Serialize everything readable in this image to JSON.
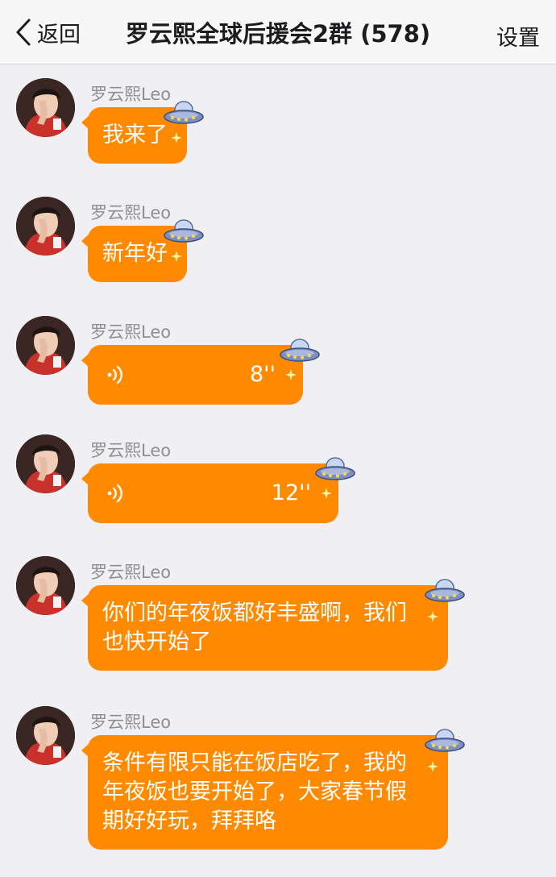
{
  "header": {
    "back_label": "返回",
    "title": "罗云熙全球后援会2群 (578)",
    "settings_label": "设置"
  },
  "colors": {
    "bubble": "#ff8a00",
    "background": "#efeff4",
    "nav_background": "#f7f7f8"
  },
  "icons": {
    "back": "chevron-left-icon",
    "avatar": "avatar",
    "voice": "voice-wave-icon",
    "decoration": "ufo-icon"
  },
  "messages": [
    {
      "sender": "罗云熙Leo",
      "type": "text",
      "text": "我来了"
    },
    {
      "sender": "罗云熙Leo",
      "type": "text",
      "text": "新年好"
    },
    {
      "sender": "罗云熙Leo",
      "type": "voice",
      "duration": "8''"
    },
    {
      "sender": "罗云熙Leo",
      "type": "voice",
      "duration": "12''"
    },
    {
      "sender": "罗云熙Leo",
      "type": "text",
      "text": "你们的年夜饭都好丰盛啊，我们\n也快开始了"
    },
    {
      "sender": "罗云熙Leo",
      "type": "text",
      "text": "条件有限只能在饭店吃了，我的\n年夜饭也要开始了，大家春节假\n期好好玩，拜拜咯"
    }
  ]
}
